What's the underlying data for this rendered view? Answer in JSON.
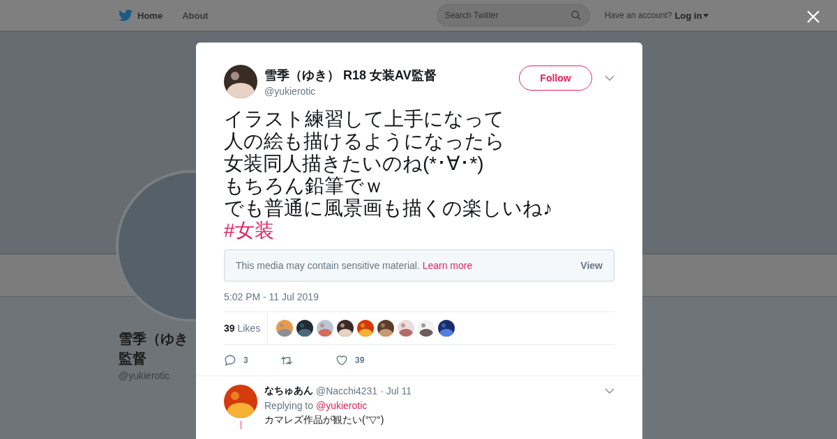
{
  "topbar": {
    "nav": [
      {
        "label": "Home",
        "selected": true
      },
      {
        "label": "About",
        "selected": false
      }
    ],
    "search": {
      "placeholder": "Search Twitter"
    },
    "account_prompt": "Have an account?",
    "login": "Log in"
  },
  "profile": {
    "name_lines": [
      "雪季（ゆき",
      "監督"
    ],
    "handle": "@yukierotic"
  },
  "tweet": {
    "author": {
      "name": "雪季（ゆき） R18 女装AV監督",
      "handle": "@yukierotic"
    },
    "follow_button": "Follow",
    "lines": [
      {
        "kind": "text",
        "text": "イラスト練習して上手になって"
      },
      {
        "kind": "text",
        "text": "人の絵も描けるようになったら"
      },
      {
        "kind": "text",
        "text": "女装同人描きたいのね(*･∀･*)"
      },
      {
        "kind": "text",
        "text": "もちろん鉛筆でｗ"
      },
      {
        "kind": "text",
        "text": "でも普通に風景画も描くの楽しいね♪"
      },
      {
        "kind": "hashtag",
        "text": "#女装"
      }
    ],
    "sensitive": {
      "message": "This media may contain sensitive material.",
      "link": "Learn more",
      "button": "View"
    },
    "timestamp": "5:02 PM - 11 Jul 2019",
    "likes": {
      "count": "39",
      "label": "Likes"
    },
    "actions": [
      {
        "kind": "reply",
        "count": "3"
      },
      {
        "kind": "retweet"
      },
      {
        "kind": "like",
        "count": "39"
      }
    ]
  },
  "reply": {
    "name": "なちゅあん",
    "handle": "@Nacchi4231",
    "date": "· Jul 11",
    "replying_label": "Replying to",
    "replying_to": "@yukierotic",
    "text": "カマレズ作品が観たい(°▽°)"
  }
}
